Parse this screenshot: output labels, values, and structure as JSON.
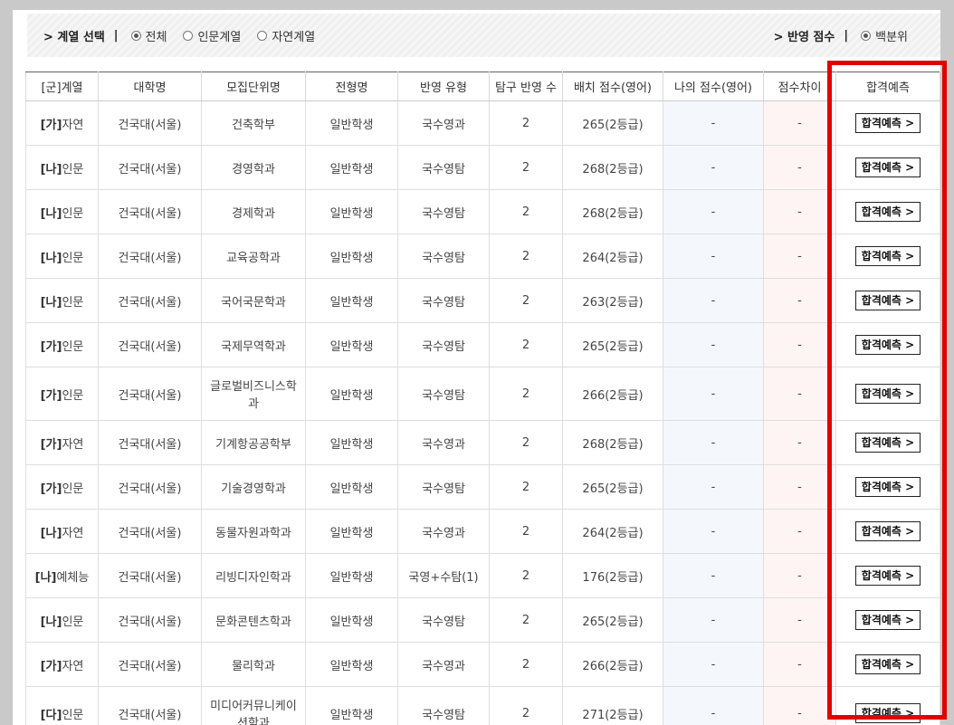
{
  "filters": {
    "left_title": "> 계열 선택",
    "left_sep": "|",
    "options": [
      {
        "label": "전체",
        "selected": true
      },
      {
        "label": "인문계열",
        "selected": false
      },
      {
        "label": "자연계열",
        "selected": false
      }
    ],
    "right_title": "> 반영 점수",
    "right_sep": "|",
    "score_option": {
      "label": "백분위",
      "selected": true
    }
  },
  "table": {
    "headers": [
      "[군]계열",
      "대학명",
      "모집단위명",
      "전형명",
      "반영 유형",
      "탐구 반영 수",
      "배치 점수(영어)",
      "나의 점수(영어)",
      "점수차이",
      "합격예측"
    ],
    "button_label": "합격예측 >",
    "rows": [
      {
        "group": "[가]",
        "track": "자연",
        "univ": "건국대(서울)",
        "major": "건축학부",
        "type": "일반학생",
        "reflect": "국수영과",
        "count": "2",
        "score": "265(2등급)",
        "mine": "-",
        "diff": "-"
      },
      {
        "group": "[나]",
        "track": "인문",
        "univ": "건국대(서울)",
        "major": "경영학과",
        "type": "일반학생",
        "reflect": "국수영탐",
        "count": "2",
        "score": "268(2등급)",
        "mine": "-",
        "diff": "-"
      },
      {
        "group": "[나]",
        "track": "인문",
        "univ": "건국대(서울)",
        "major": "경제학과",
        "type": "일반학생",
        "reflect": "국수영탐",
        "count": "2",
        "score": "268(2등급)",
        "mine": "-",
        "diff": "-"
      },
      {
        "group": "[나]",
        "track": "인문",
        "univ": "건국대(서울)",
        "major": "교육공학과",
        "type": "일반학생",
        "reflect": "국수영탐",
        "count": "2",
        "score": "264(2등급)",
        "mine": "-",
        "diff": "-"
      },
      {
        "group": "[나]",
        "track": "인문",
        "univ": "건국대(서울)",
        "major": "국어국문학과",
        "type": "일반학생",
        "reflect": "국수영탐",
        "count": "2",
        "score": "263(2등급)",
        "mine": "-",
        "diff": "-"
      },
      {
        "group": "[가]",
        "track": "인문",
        "univ": "건국대(서울)",
        "major": "국제무역학과",
        "type": "일반학생",
        "reflect": "국수영탐",
        "count": "2",
        "score": "265(2등급)",
        "mine": "-",
        "diff": "-"
      },
      {
        "group": "[가]",
        "track": "인문",
        "univ": "건국대(서울)",
        "major": "글로벌비즈니스학과",
        "type": "일반학생",
        "reflect": "국수영탐",
        "count": "2",
        "score": "266(2등급)",
        "mine": "-",
        "diff": "-"
      },
      {
        "group": "[가]",
        "track": "자연",
        "univ": "건국대(서울)",
        "major": "기계항공공학부",
        "type": "일반학생",
        "reflect": "국수영과",
        "count": "2",
        "score": "268(2등급)",
        "mine": "-",
        "diff": "-"
      },
      {
        "group": "[가]",
        "track": "인문",
        "univ": "건국대(서울)",
        "major": "기술경영학과",
        "type": "일반학생",
        "reflect": "국수영탐",
        "count": "2",
        "score": "265(2등급)",
        "mine": "-",
        "diff": "-"
      },
      {
        "group": "[나]",
        "track": "자연",
        "univ": "건국대(서울)",
        "major": "동물자원과학과",
        "type": "일반학생",
        "reflect": "국수영과",
        "count": "2",
        "score": "264(2등급)",
        "mine": "-",
        "diff": "-"
      },
      {
        "group": "[나]",
        "track": "예체능",
        "univ": "건국대(서울)",
        "major": "리빙디자인학과",
        "type": "일반학생",
        "reflect": "국영+수탐(1)",
        "count": "2",
        "score": "176(2등급)",
        "mine": "-",
        "diff": "-"
      },
      {
        "group": "[나]",
        "track": "인문",
        "univ": "건국대(서울)",
        "major": "문화콘텐츠학과",
        "type": "일반학생",
        "reflect": "국수영탐",
        "count": "2",
        "score": "265(2등급)",
        "mine": "-",
        "diff": "-"
      },
      {
        "group": "[가]",
        "track": "자연",
        "univ": "건국대(서울)",
        "major": "물리학과",
        "type": "일반학생",
        "reflect": "국수영과",
        "count": "2",
        "score": "266(2등급)",
        "mine": "-",
        "diff": "-"
      },
      {
        "group": "[다]",
        "track": "인문",
        "univ": "건국대(서울)",
        "major": "미디어커뮤니케이션학과",
        "type": "일반학생",
        "reflect": "국수영탐",
        "count": "2",
        "score": "271(2등급)",
        "mine": "-",
        "diff": "-"
      }
    ]
  },
  "colors": {
    "highlight": "#e00000",
    "my_score_bg": "#f4f8fc",
    "diff_bg": "#fdf4f3"
  }
}
